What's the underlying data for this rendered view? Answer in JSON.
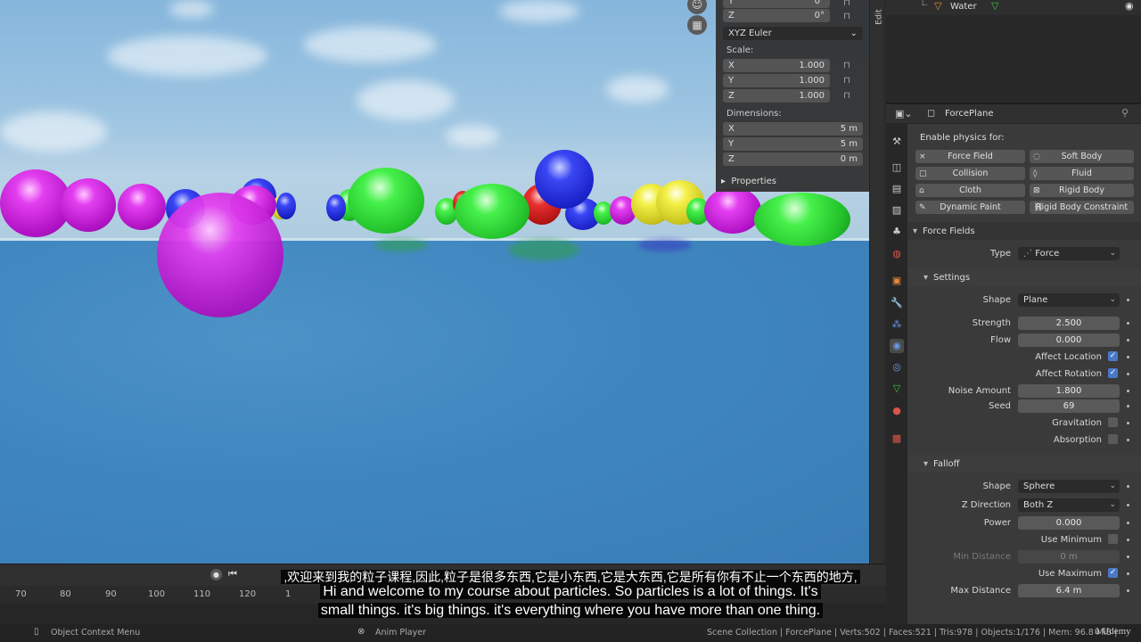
{
  "viewport": {
    "rotation_z": {
      "axis": "Z",
      "value": "0°"
    },
    "rotation_mode": "XYZ Euler",
    "scale_label": "Scale:",
    "scale": [
      {
        "axis": "X",
        "value": "1.000"
      },
      {
        "axis": "Y",
        "value": "1.000"
      },
      {
        "axis": "Z",
        "value": "1.000"
      }
    ],
    "dimensions_label": "Dimensions:",
    "dimensions": [
      {
        "axis": "X",
        "value": "5 m"
      },
      {
        "axis": "Y",
        "value": "5 m"
      },
      {
        "axis": "Z",
        "value": "0 m"
      }
    ],
    "properties_section": "Properties",
    "edit_tab": "Edit"
  },
  "outliner": {
    "item": "Water"
  },
  "properties": {
    "object_name": "ForcePlane",
    "enable_physics_label": "Enable physics for:",
    "physics_buttons": [
      {
        "label": "Force Field",
        "icon": "×"
      },
      {
        "label": "Soft Body",
        "icon": "◌"
      },
      {
        "label": "Collision",
        "icon": "▢"
      },
      {
        "label": "Fluid",
        "icon": "◊"
      },
      {
        "label": "Cloth",
        "icon": "⌂"
      },
      {
        "label": "Rigid Body",
        "icon": "⊠"
      },
      {
        "label": "Dynamic Paint",
        "icon": "✎"
      },
      {
        "label": "Rigid Body Constraint",
        "icon": "⛓"
      }
    ],
    "force_fields_header": "Force Fields",
    "type_label": "Type",
    "type_value": "Force",
    "settings_header": "Settings",
    "shape_label": "Shape",
    "shape_value": "Plane",
    "strength_label": "Strength",
    "strength_value": "2.500",
    "flow_label": "Flow",
    "flow_value": "0.000",
    "affect_location_label": "Affect Location",
    "affect_rotation_label": "Affect Rotation",
    "noise_amount_label": "Noise Amount",
    "noise_amount_value": "1.800",
    "seed_label": "Seed",
    "seed_value": "69",
    "gravitation_label": "Gravitation",
    "absorption_label": "Absorption",
    "falloff_header": "Falloff",
    "falloff_shape_label": "Shape",
    "falloff_shape_value": "Sphere",
    "z_direction_label": "Z Direction",
    "z_direction_value": "Both Z",
    "power_label": "Power",
    "power_value": "0.000",
    "use_minimum_label": "Use Minimum",
    "min_distance_label": "Min Distance",
    "min_distance_value": "0 m",
    "use_maximum_label": "Use Maximum",
    "max_distance_label": "Max Distance",
    "max_distance_value": "6.4 m"
  },
  "timeline": {
    "ticks": [
      "70",
      "80",
      "90",
      "100",
      "110",
      "120",
      "1"
    ]
  },
  "status": {
    "left": "Object Context Menu",
    "middle": "Anim Player",
    "right": "Scene Collection | ForcePlane | Verts:502 | Faces:521 | Tris:978 | Objects:1/176 | Mem: 96.8 MiB |",
    "watermark": "Udemy"
  },
  "subtitles": {
    "chinese": ",欢迎来到我的粒子课程,因此,粒子是很多东西,它是小东西,它是大东西,它是所有你有不止一个东西的地方,",
    "english_line1": "Hi and welcome to my course about particles. So particles is a lot of things. It's",
    "english_line2": "small things. it's big things. it's everything where you have more than one thing."
  },
  "colors": {
    "accent_check": "#4a78c8",
    "panel_bg": "#3a3a3a",
    "sky": "#9fc6e2",
    "water": "#3f86bf"
  }
}
